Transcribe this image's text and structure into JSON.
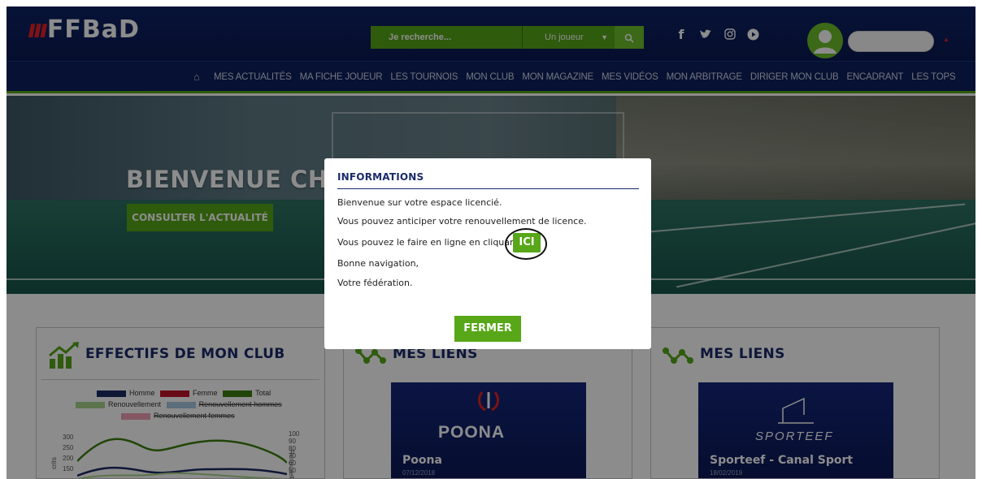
{
  "header": {
    "logo_mark": "ııı",
    "logo_text": "FFBaD",
    "search_placeholder": "Je recherche...",
    "search_type": "Un joueur",
    "search_icon": "search-icon",
    "social_icons": [
      "facebook-icon",
      "twitter-icon",
      "instagram-icon",
      "youtube-icon"
    ]
  },
  "nav": {
    "home_icon": "home-icon",
    "items": [
      "MES ACTUALITÉS",
      "MA FICHE JOUEUR",
      "LES TOURNOIS",
      "MON CLUB",
      "MON MAGAZINE",
      "MES VIDÉOS",
      "MON ARBITRAGE",
      "DIRIGER MON CLUB",
      "ENCADRANT",
      "LES TOPS"
    ]
  },
  "hero": {
    "title": "BIENVENUE CHEZ VOUS",
    "button": "CONSULTER L'ACTUALITÉ"
  },
  "cards": {
    "effectifs": {
      "title": "EFFECTIFS DE MON CLUB",
      "legend": [
        "Homme",
        "Femme",
        "Total",
        "Renouvellement",
        "Renouvellement hommes",
        "Renouvellement femmes"
      ],
      "y_left": [
        "300",
        "250",
        "200",
        "150"
      ],
      "y_right": [
        "100",
        "90",
        "80",
        "70",
        "60",
        "50"
      ],
      "y_right_label": "Renouvelle",
      "y_left_label": "crits"
    },
    "liens1": {
      "title": "MES LIENS",
      "media_title": "Poona",
      "media_date": "07/12/2018",
      "media_brand": "POONA"
    },
    "liens2": {
      "title": "MES LIENS",
      "media_title": "Sporteef - Canal Sport",
      "media_date": "18/02/2019",
      "media_brand": "SPORTEEF"
    }
  },
  "modal": {
    "title": "INFORMATIONS",
    "line1": "Bienvenue sur votre espace licencié.",
    "line2": "Vous pouvez anticiper votre renouvellement de licence.",
    "line3": "Vous pouvez le faire en ligne en cliquant",
    "ici": "ICI",
    "line4": "Bonne navigation,",
    "line5": "Votre fédération.",
    "close": "FERMER"
  },
  "colors": {
    "navy": "#0c1f5e",
    "green": "#57a718",
    "red": "#e32126"
  }
}
